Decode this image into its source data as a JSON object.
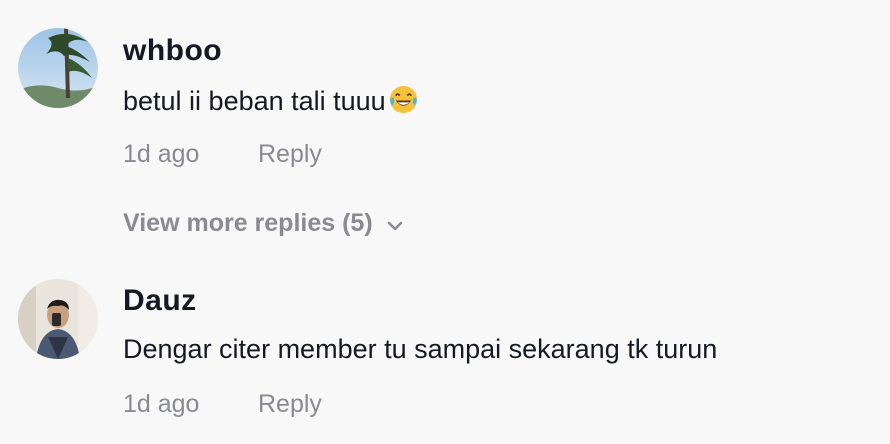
{
  "comments": [
    {
      "username": "whboo",
      "text": "betul ii beban tali tuuu",
      "emoji_icon": "face-with-tears-of-joy-icon",
      "time": "1d ago",
      "reply_label": "Reply"
    },
    {
      "username": "Dauz",
      "text": "Dengar citer member tu sampai sekarang tk turun",
      "time": "1d ago",
      "reply_label": "Reply"
    }
  ],
  "view_more": {
    "label": "View more replies (5)",
    "icon": "chevron-down-icon"
  },
  "colors": {
    "background": "#f8f8f8",
    "primary_text": "#161823",
    "secondary_text": "#8a8b91"
  }
}
